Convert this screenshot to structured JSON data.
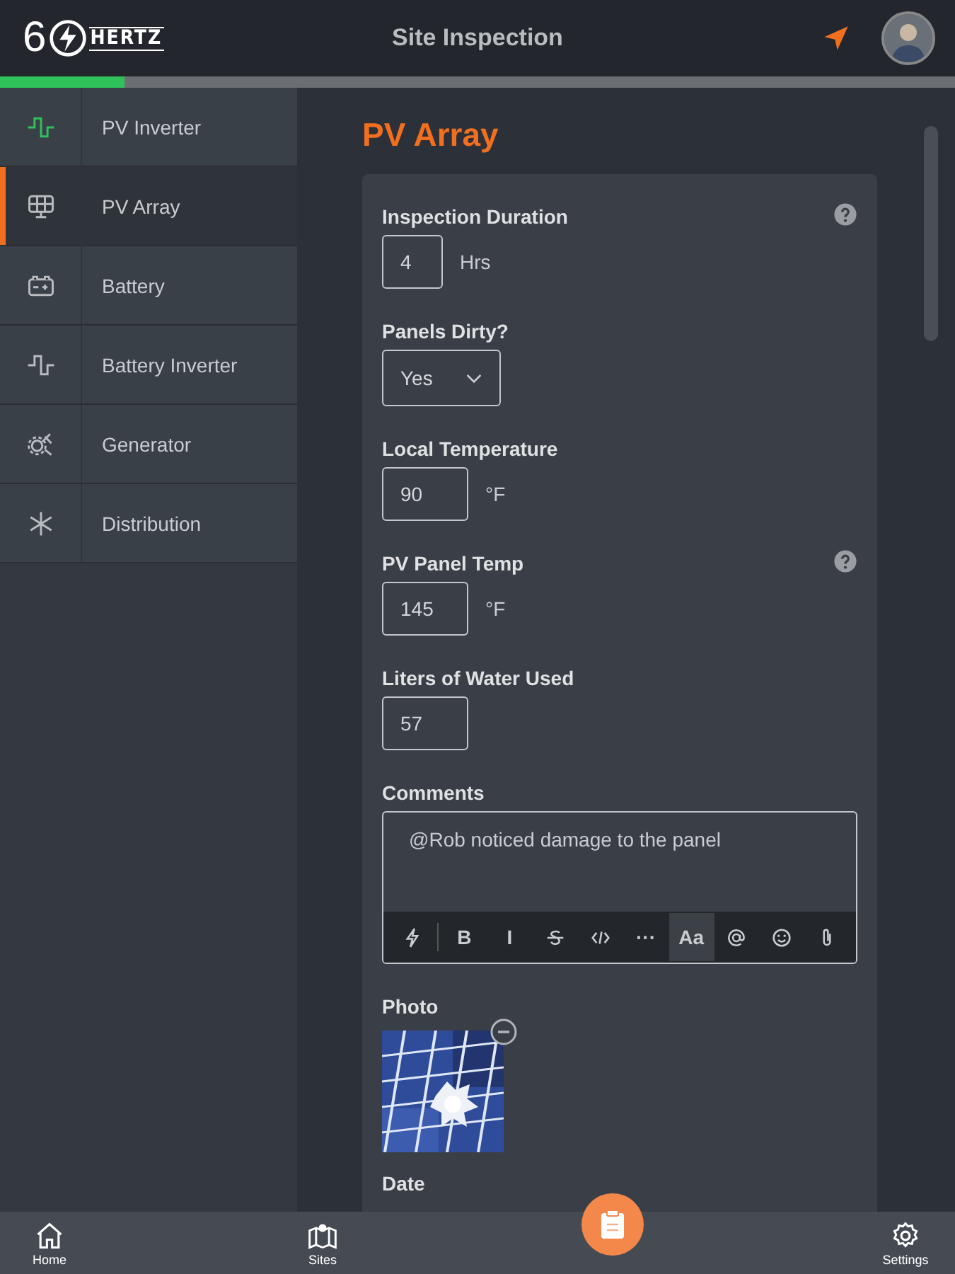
{
  "header": {
    "logo": {
      "digit": "6",
      "word": "HERTZ"
    },
    "title": "Site Inspection",
    "progress": {
      "level": 0.13
    }
  },
  "sidebar": {
    "items": [
      {
        "label": "PV Inverter",
        "kind": "inverter",
        "selected": false,
        "completed": true
      },
      {
        "label": "PV Array",
        "kind": "solar",
        "selected": true,
        "completed": false
      },
      {
        "label": "Battery",
        "kind": "battery",
        "selected": false,
        "completed": false
      },
      {
        "label": "Battery Inverter",
        "kind": "inverter",
        "selected": false,
        "completed": false
      },
      {
        "label": "Generator",
        "kind": "generator",
        "selected": false,
        "completed": false
      },
      {
        "label": "Distribution",
        "kind": "distribution",
        "selected": false,
        "completed": false
      }
    ]
  },
  "page": {
    "title": "PV Array"
  },
  "form": {
    "fields": [
      {
        "kind": "number",
        "label": "Inspection Duration",
        "value": "4",
        "unit": "Hrs",
        "help": true
      },
      {
        "kind": "select",
        "label": "Panels Dirty?",
        "value": "Yes",
        "help": false
      },
      {
        "kind": "number",
        "label": "Local Temperature",
        "value": "90",
        "unit": "°F",
        "help": false
      },
      {
        "kind": "number",
        "label": "PV Panel Temp",
        "value": "145",
        "unit": "°F",
        "help": true
      },
      {
        "kind": "number",
        "label": "Liters of Water Used",
        "value": "57",
        "help": false
      },
      {
        "kind": "comments",
        "label": "Comments",
        "value": "@Rob noticed damage to the panel",
        "help": false,
        "toolbar": [
          {
            "kind": "bolt",
            "selected": false
          },
          {
            "kind": "text",
            "label": "B",
            "selected": false
          },
          {
            "kind": "text",
            "label": "I",
            "selected": false
          },
          {
            "kind": "strike",
            "selected": false
          },
          {
            "kind": "code",
            "selected": false
          },
          {
            "kind": "text",
            "label": "···",
            "selected": false
          },
          {
            "kind": "text",
            "label": "Aa",
            "selected": true
          },
          {
            "kind": "mention",
            "selected": false
          },
          {
            "kind": "emoji",
            "selected": false
          },
          {
            "kind": "attach",
            "selected": false
          }
        ]
      },
      {
        "label": "Photo",
        "help": false
      },
      {
        "kind": "label",
        "label": "Date",
        "help": false
      }
    ]
  },
  "bottom_nav": {
    "items": [
      {
        "kind": "home",
        "label": "Home"
      },
      {
        "kind": "sites",
        "label": "Sites"
      },
      {
        "kind": "fab"
      },
      {
        "kind": "settings",
        "label": "Settings"
      }
    ]
  }
}
